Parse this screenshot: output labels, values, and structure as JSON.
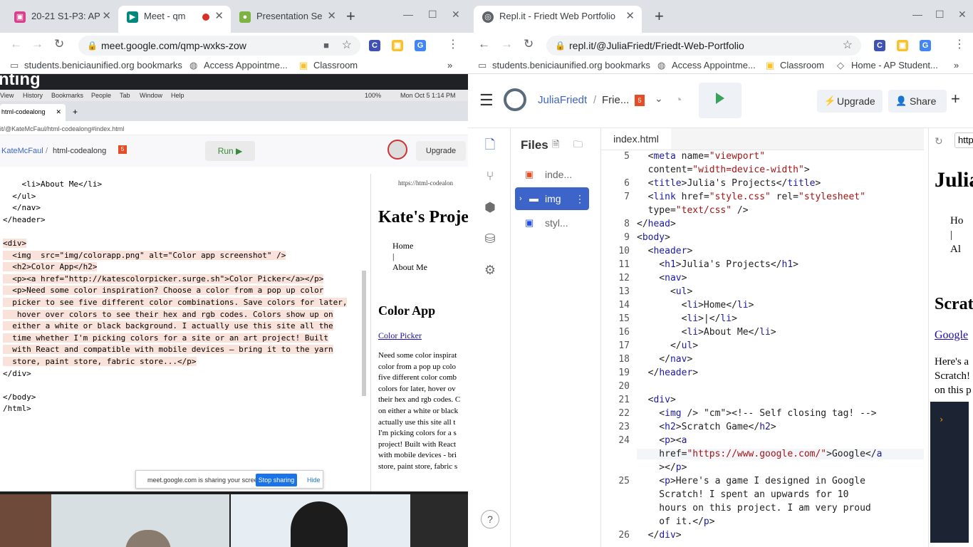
{
  "left_window": {
    "tabs": [
      {
        "title": "20-21 S1-P3: AP",
        "icon_color": "#d93f8a"
      },
      {
        "title": "Meet - qmp-wxks-zow",
        "icon_color": "#00897b"
      },
      {
        "title": "Presentation Se",
        "icon_color": "#7cb342"
      }
    ],
    "url": "meet.google.com/qmp-wxks-zow",
    "bookmarks": [
      "students.beniciaunified.org bookmarks",
      "Access Appointme...",
      "Classroom"
    ],
    "shared_screen": {
      "heading_partial": "nting",
      "mac_menu": [
        "View",
        "History",
        "Bookmarks",
        "People",
        "Tab",
        "Window",
        "Help"
      ],
      "mac_clock": "Mon Oct 5  1:14 PM",
      "mac_battery": "100%",
      "tab_title": "html-codealong",
      "url": "it/@KateMcFaul/html-codealong#index.html",
      "user": "KateMcFaul",
      "project": "html-codealong",
      "run_label": "Run ▶",
      "upgrade_label": "Upgrade",
      "preview_url": "https://html-codealon",
      "code_lines": [
        "    <li>About Me</li>",
        "  </ul>",
        "  </nav>",
        "</header>",
        "",
        "<div>",
        "  <img  src=\"img/colorapp.png\" alt=\"Color app screenshot\" />",
        "  <h2>Color App</h2>",
        "  <p><a href=\"http://katescolorpicker.surge.sh\">Color Picker</a></p>",
        "  <p>Need some color inspiration? Choose a color from a pop up color",
        "  picker to see five different color combinations. Save colors for later,",
        "   hover over colors to see their hex and rgb codes. Colors show up on",
        "  either a white or black background. I actually use this site all the",
        "  time whether I'm picking colors for a site or an art project! Built",
        "  with React and compatible with mobile devices — bring it to the yarn",
        "  store, paint store, fabric store...</p>",
        "</div>",
        "",
        "</body>",
        "/html>"
      ],
      "preview": {
        "h1": "Kate's Projec",
        "nav": [
          "Home",
          "|",
          "About Me"
        ],
        "h2": "Color App",
        "link": "Color Picker",
        "para": [
          "Need some color inspirat",
          "color from a pop up colo",
          "five different color comb",
          "colors for later, hover ov",
          "their hex and rgb codes. C",
          "on either a white or black",
          "actually use this site all t",
          "I'm picking colors for a s",
          "project! Built with React",
          "with mobile devices - bri",
          "store, paint store, fabric s"
        ]
      },
      "share_notice": "meet.google.com is sharing your screen.",
      "stop_sharing": "Stop sharing",
      "hide": "Hide"
    }
  },
  "right_window": {
    "tab_title": "Repl.it - Friedt Web Portfolio",
    "url": "repl.it/@JuliaFriedt/Friedt-Web-Portfolio",
    "bookmarks": [
      "students.beniciaunified.org bookmarks",
      "Access Appointme...",
      "Classroom",
      "Home - AP Student..."
    ],
    "user": "JuliaFriedt",
    "project_short": "Frie...",
    "upgrade_label": "Upgrade",
    "share_label": "Share",
    "files_title": "Files",
    "files": [
      {
        "name": "inde...",
        "icon": "5"
      },
      {
        "name": "img",
        "icon": "folder"
      },
      {
        "name": "styl...",
        "icon": "3"
      }
    ],
    "editor_tab": "index.html",
    "code": [
      {
        "n": "5",
        "t": "  <meta name=\"viewport\""
      },
      {
        "n": "",
        "t": "  content=\"width=device-width\">"
      },
      {
        "n": "6",
        "t": "  <title>Julia's Projects</title>"
      },
      {
        "n": "7",
        "t": "  <link href=\"style.css\" rel=\"stylesheet\""
      },
      {
        "n": "",
        "t": "  type=\"text/css\" />"
      },
      {
        "n": "8",
        "t": "</head>"
      },
      {
        "n": "9",
        "t": "<body>"
      },
      {
        "n": "10",
        "t": "  <header>"
      },
      {
        "n": "11",
        "t": "    <h1>Julia's Projects</h1>"
      },
      {
        "n": "12",
        "t": "    <nav>"
      },
      {
        "n": "13",
        "t": "      <ul>"
      },
      {
        "n": "14",
        "t": "        <li>Home</li>"
      },
      {
        "n": "15",
        "t": "        <li>|</li>"
      },
      {
        "n": "16",
        "t": "        <li>About Me</li>"
      },
      {
        "n": "17",
        "t": "      </ul>"
      },
      {
        "n": "18",
        "t": "    </nav>"
      },
      {
        "n": "19",
        "t": "  </header>"
      },
      {
        "n": "20",
        "t": ""
      },
      {
        "n": "21",
        "t": "  <div>"
      },
      {
        "n": "22",
        "t": "    <img /> <!-- Self closing tag! -->"
      },
      {
        "n": "23",
        "t": "    <h2>Scratch Game</h2>"
      },
      {
        "n": "24",
        "t": "    <p><a"
      },
      {
        "n": "",
        "t": "    href=\"https://www.google.com/\">Google</a"
      },
      {
        "n": "",
        "t": "    ></p>"
      },
      {
        "n": "25",
        "t": "    <p>Here's a game I designed in Google"
      },
      {
        "n": "",
        "t": "    Scratch! I spent an upwards for 10"
      },
      {
        "n": "",
        "t": "    hours on this project. I am very proud"
      },
      {
        "n": "",
        "t": "    of it.</p>"
      },
      {
        "n": "26",
        "t": "  </div>"
      }
    ],
    "preview": {
      "url": "http",
      "h1": "Julia",
      "nav": [
        "Ho",
        "|",
        "Al"
      ],
      "h2": "Scrat",
      "link": "Google",
      "para": [
        "Here's a",
        "Scratch!",
        "on this p"
      ]
    }
  }
}
